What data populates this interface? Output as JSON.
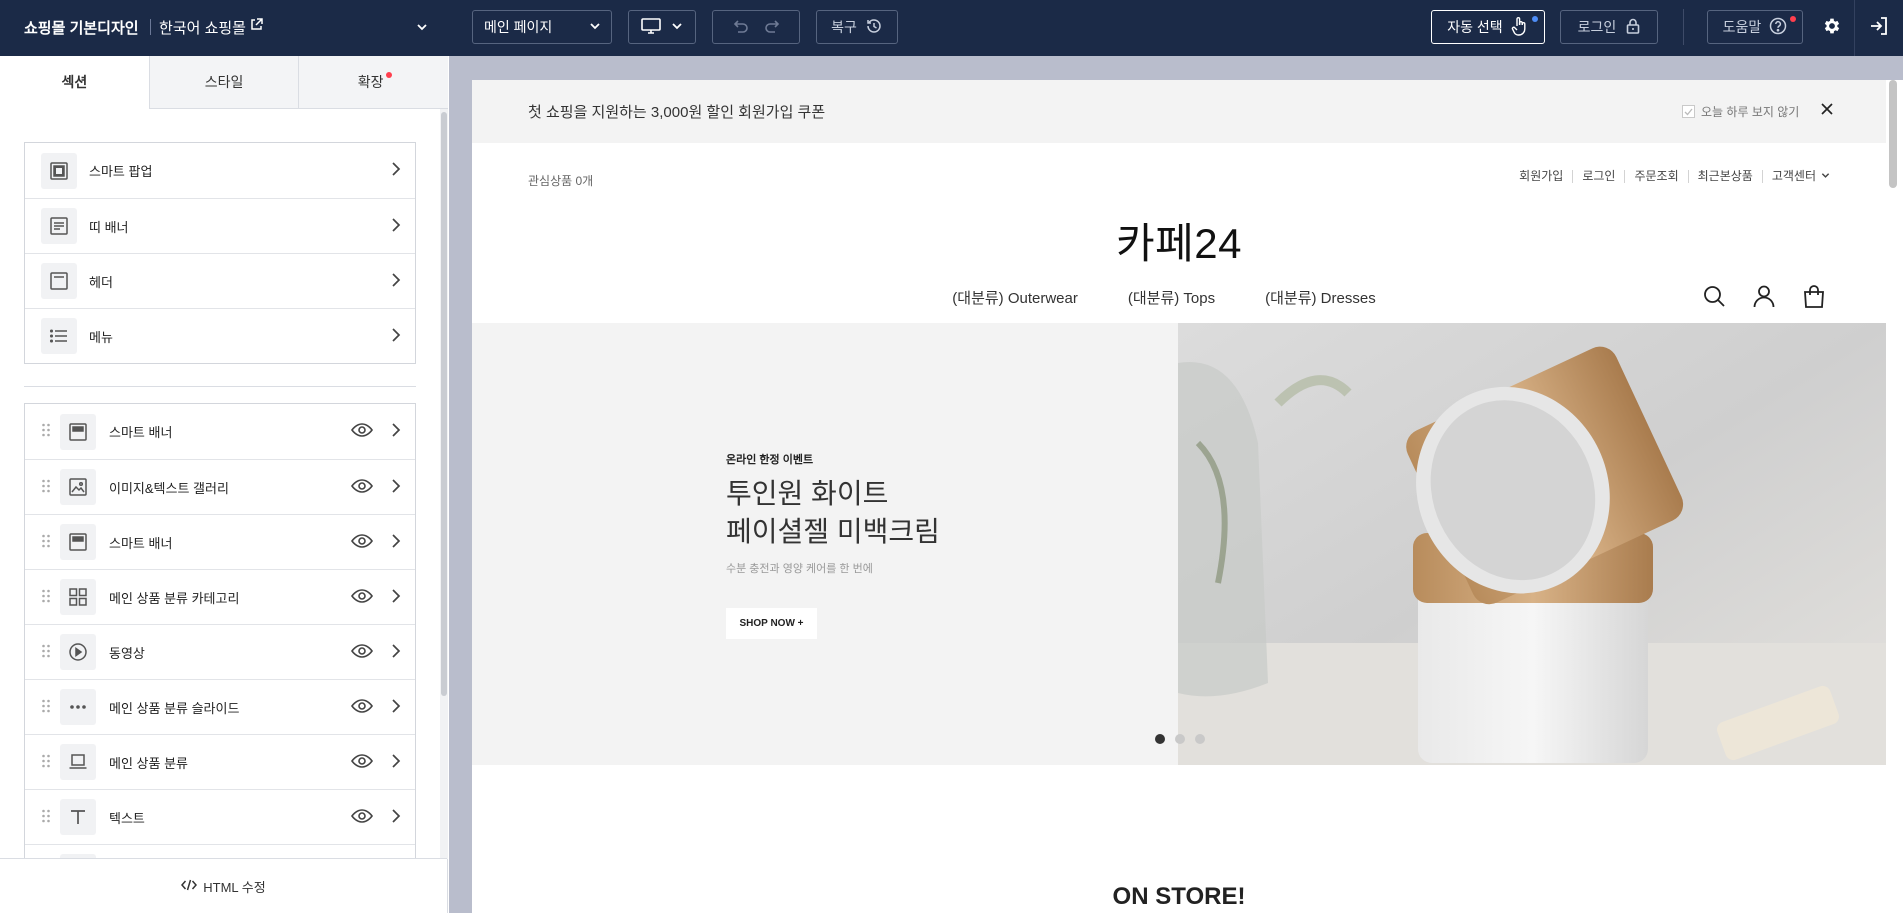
{
  "topbar": {
    "title": "쇼핑몰 기본디자인",
    "shop_name": "한국어 쇼핑몰",
    "page_select": "메인 페이지",
    "restore_label": "복구",
    "auto_select_label": "자동 선택",
    "login_label": "로그인",
    "help_label": "도움말",
    "icons": [
      "external-link-icon",
      "chevron-down-icon",
      "monitor-icon",
      "undo-icon",
      "redo-icon",
      "history-icon",
      "hand-pointer-icon",
      "lock-icon",
      "question-icon",
      "gear-icon",
      "exit-icon"
    ]
  },
  "panel": {
    "tabs": [
      {
        "label": "섹션",
        "active": true
      },
      {
        "label": "스타일",
        "active": false
      },
      {
        "label": "확장",
        "active": false,
        "badge": true
      }
    ],
    "fixed_sections": [
      {
        "label": "스마트 팝업",
        "icon": "popup-icon"
      },
      {
        "label": "띠 배너",
        "icon": "strip-banner-icon"
      },
      {
        "label": "헤더",
        "icon": "header-icon"
      },
      {
        "label": "메뉴",
        "icon": "list-icon"
      }
    ],
    "sections": [
      {
        "label": "스마트 배너",
        "icon": "banner-icon"
      },
      {
        "label": "이미지&텍스트 갤러리",
        "icon": "image-icon"
      },
      {
        "label": "스마트 배너",
        "icon": "banner-icon"
      },
      {
        "label": "메인 상품 분류 카테고리",
        "icon": "grid-icon"
      },
      {
        "label": "동영상",
        "icon": "play-icon"
      },
      {
        "label": "메인 상품 분류 슬라이드",
        "icon": "ellipsis-icon"
      },
      {
        "label": "메인 상품 분류",
        "icon": "laptop-icon"
      },
      {
        "label": "텍스트",
        "icon": "text-icon"
      }
    ],
    "footer_label": "HTML 수정"
  },
  "site": {
    "coupon_text": "첫 쇼핑을 지원하는 3,000원 할인 회원가입 쿠폰",
    "coupon_checkbox_label": "오늘 하루 보지 않기",
    "wishlist": "관심상품 0개",
    "util_links": [
      "회원가입",
      "로그인",
      "주문조회",
      "최근본상품",
      "고객센터"
    ],
    "logo": "카페24",
    "nav": [
      "(대분류) Outerwear",
      "(대분류) Tops",
      "(대분류) Dresses"
    ],
    "hero": {
      "tag": "온라인 한정 이벤트",
      "title_line1": "투인원 화이트",
      "title_line2": "페이셜젤 미백크림",
      "subtitle": "수분 충전과 영양 케어를 한 번에",
      "button": "SHOP NOW +",
      "slides": 3,
      "active_slide": 1
    },
    "section_title": "ON STORE!"
  }
}
